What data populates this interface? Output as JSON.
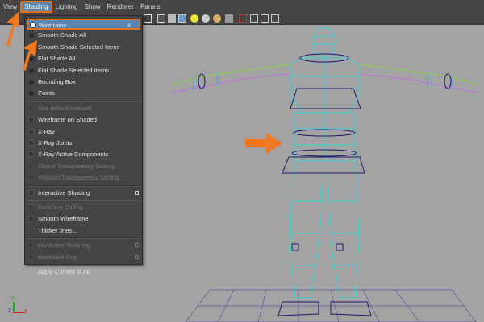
{
  "menubar": {
    "items": [
      "View",
      "Shading",
      "Lighting",
      "Show",
      "Renderer",
      "Panels"
    ]
  },
  "shading_menu": {
    "items": [
      {
        "label": "Wireframe",
        "hotkey": "4",
        "type": "radio",
        "selected": true
      },
      {
        "label": "Smooth Shade All",
        "type": "radio"
      },
      {
        "label": "Smooth Shade Selected Items",
        "type": "radio"
      },
      {
        "label": "Flat Shade All",
        "type": "radio"
      },
      {
        "label": "Flat Shade Selected Items",
        "type": "radio"
      },
      {
        "label": "Bounding Box",
        "type": "radio"
      },
      {
        "label": "Points",
        "type": "radio"
      },
      {
        "label": "Use default material",
        "type": "check",
        "disabled": true
      },
      {
        "label": "Wireframe on Shaded",
        "type": "check"
      },
      {
        "label": "X-Ray",
        "type": "check"
      },
      {
        "label": "X-Ray Joints",
        "type": "check"
      },
      {
        "label": "X-Ray Active Components",
        "type": "check"
      },
      {
        "label": "Object Transparency Sorting",
        "type": "check",
        "disabled": true
      },
      {
        "label": "Polygon Transparency Sorting",
        "type": "check",
        "disabled": true
      },
      {
        "label": "Interactive Shading",
        "type": "check",
        "option": true
      },
      {
        "label": "Backface Culling",
        "type": "check",
        "disabled": true
      },
      {
        "label": "Smooth Wireframe",
        "type": "check"
      },
      {
        "label": "Thicker lines...",
        "type": "none"
      },
      {
        "label": "Hardware Texturing",
        "type": "check",
        "disabled": true,
        "option": true
      },
      {
        "label": "Hardware Fog",
        "type": "check",
        "disabled": true,
        "option": true
      },
      {
        "label": "Apply Current to All",
        "type": "none"
      }
    ]
  },
  "axis_labels": {
    "x": "x",
    "y": "y",
    "z": "z"
  },
  "colors": {
    "highlight": "#5b86b1",
    "annotation": "#f07820",
    "menu_bg": "#444444",
    "viewport_bg": "#a3a3a3"
  }
}
